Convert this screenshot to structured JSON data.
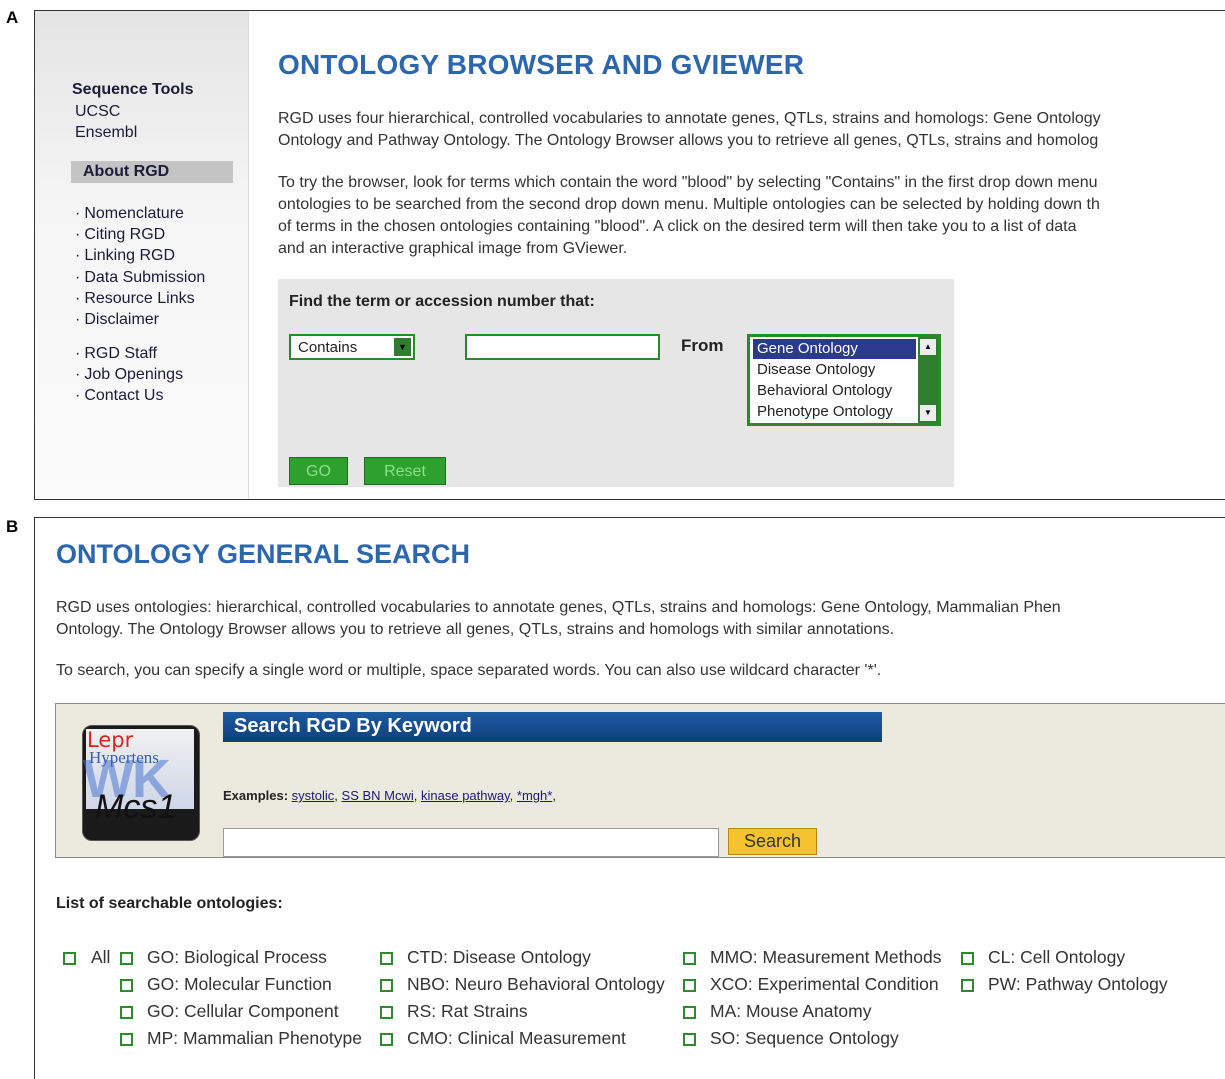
{
  "panel_labels": {
    "a": "A",
    "b": "B"
  },
  "panel_a": {
    "sidebar": {
      "sequence_heading": "Sequence Tools",
      "sequence_links": [
        "UCSC",
        "Ensembl"
      ],
      "about_heading": "About RGD",
      "group1": [
        "Nomenclature",
        "Citing RGD",
        "Linking RGD",
        "Data Submission",
        "Resource Links",
        "Disclaimer"
      ],
      "group2": [
        "RGD Staff",
        "Job Openings",
        "Contact Us"
      ],
      "bullet": "·"
    },
    "title": "ONTOLOGY BROWSER AND GVIEWER",
    "para1": [
      "RGD uses four hierarchical, controlled vocabularies to annotate genes, QTLs, strains and homologs: Gene Ontology",
      "Ontology and Pathway Ontology. The Ontology Browser allows you to retrieve all genes, QTLs, strains and homolog"
    ],
    "para2": [
      "To try the browser, look for terms which contain the word \"blood\" by selecting \"Contains\" in the first drop down menu",
      "ontologies to be searched from the second drop down menu. Multiple ontologies can be selected by holding down th",
      "of terms in the chosen ontologies containing \"blood\". A click on the desired term will then take you to a list of data",
      "and an interactive graphical image from GViewer."
    ],
    "form": {
      "find_label": "Find the term or accession number that:",
      "match_select_value": "Contains",
      "term_input_value": "",
      "from_label": "From",
      "ontology_options": [
        "Gene Ontology",
        "Disease Ontology",
        "Behavioral Ontology",
        "Phenotype Ontology"
      ],
      "selected_option": "Gene Ontology",
      "go_label": "GO",
      "reset_label": "Reset"
    }
  },
  "panel_b": {
    "title": "ONTOLOGY GENERAL SEARCH",
    "para1": [
      "RGD uses ontologies: hierarchical, controlled vocabularies to annotate genes, QTLs, strains and homologs: Gene Ontology, Mammalian Phen",
      "Ontology. The Ontology Browser allows you to retrieve all genes, QTLs, strains and homologs with similar annotations."
    ],
    "para2": "To search, you can specify a single word or multiple, space separated words. You can also use wildcard character '*'.",
    "search": {
      "logo_text": {
        "line1": "Lepr",
        "line2": "Hypertens",
        "line3": "WK",
        "line4": "Mcs1"
      },
      "bar_title": "Search RGD By Keyword",
      "examples_label": "Examples:",
      "examples": [
        "systolic",
        "SS BN Mcwi",
        "kinase pathway",
        "*mgh*"
      ],
      "input_value": "",
      "button_label": "Search"
    },
    "list_heading": "List of searchable ontologies:",
    "all_label": "All",
    "ontologies": [
      [
        "GO: Biological Process",
        "GO: Molecular Function",
        "GO: Cellular Component",
        "MP: Mammalian Phenotype"
      ],
      [
        "CTD: Disease Ontology",
        "NBO: Neuro Behavioral Ontology",
        "RS: Rat Strains",
        "CMO: Clinical Measurement"
      ],
      [
        "MMO: Measurement Methods",
        "XCO: Experimental Condition",
        "MA: Mouse Anatomy",
        "SO: Sequence Ontology"
      ],
      [
        "CL: Cell Ontology",
        "PW: Pathway Ontology"
      ]
    ],
    "checked_all": false
  },
  "colors": {
    "title_blue": "#2c67ad",
    "form_green": "#2a8a2a",
    "search_bar_blue": "#1d5aa0",
    "search_button_yellow": "#f6c330"
  }
}
